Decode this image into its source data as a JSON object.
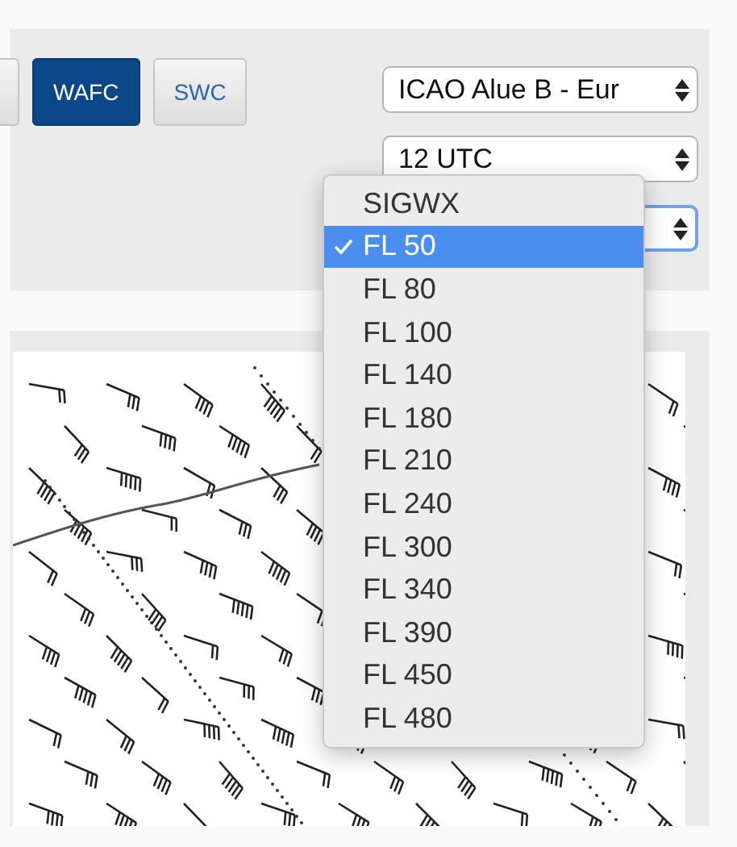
{
  "toolbar": {
    "buttons": [
      {
        "kind": "partial",
        "selected": false
      },
      {
        "label": "WAFC",
        "selected": true
      },
      {
        "label": "SWC",
        "selected": false
      }
    ]
  },
  "selects": [
    {
      "value": "ICAO Alue B - Eur",
      "focused": false
    },
    {
      "value": "12 UTC",
      "focused": false
    },
    {
      "focused": true
    }
  ],
  "level_menu": {
    "items": [
      {
        "label": "SIGWX",
        "selected": false
      },
      {
        "label": "FL 50",
        "selected": true
      },
      {
        "label": "FL 80",
        "selected": false
      },
      {
        "label": "FL 100",
        "selected": false
      },
      {
        "label": "FL 140",
        "selected": false
      },
      {
        "label": "FL 180",
        "selected": false
      },
      {
        "label": "FL 210",
        "selected": false
      },
      {
        "label": "FL 240",
        "selected": false
      },
      {
        "label": "FL 300",
        "selected": false
      },
      {
        "label": "FL 340",
        "selected": false
      },
      {
        "label": "FL 390",
        "selected": false
      },
      {
        "label": "FL 450",
        "selected": false
      },
      {
        "label": "FL 480",
        "selected": false
      }
    ]
  }
}
